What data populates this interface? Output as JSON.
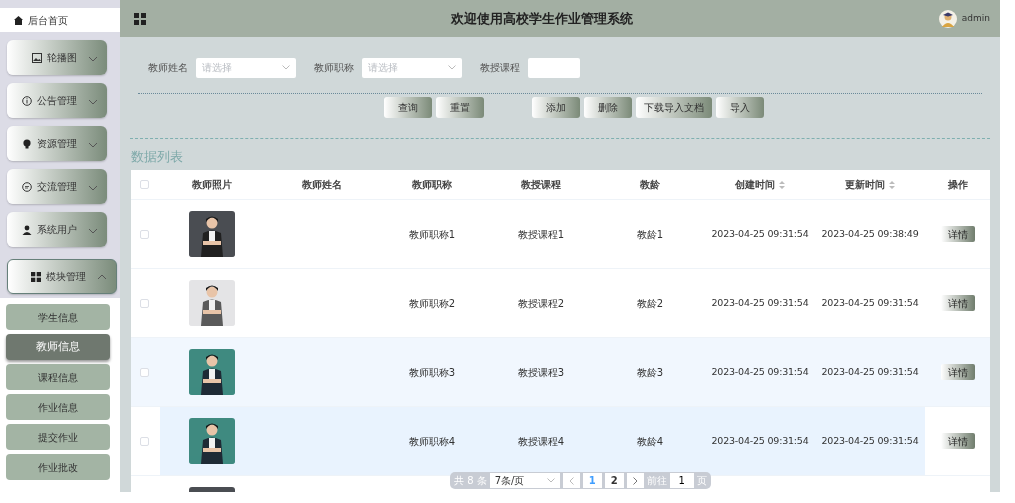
{
  "sidebar": {
    "home": {
      "label": "后台首页"
    },
    "menus": [
      {
        "label": "轮播图",
        "expanded": false
      },
      {
        "label": "公告管理",
        "expanded": false
      },
      {
        "label": "资源管理",
        "expanded": false
      },
      {
        "label": "交流管理",
        "expanded": false
      },
      {
        "label": "系统用户",
        "expanded": false
      },
      {
        "label": "模块管理",
        "expanded": true,
        "children": [
          {
            "label": "学生信息",
            "selected": false
          },
          {
            "label": "教师信息",
            "selected": true
          },
          {
            "label": "课程信息",
            "selected": false
          },
          {
            "label": "作业信息",
            "selected": false
          },
          {
            "label": "提交作业",
            "selected": false
          },
          {
            "label": "作业批改",
            "selected": false
          }
        ]
      }
    ]
  },
  "header": {
    "title": "欢迎使用高校学生作业管理系统",
    "user": "admin"
  },
  "filters": [
    {
      "label": "教师姓名",
      "kind": "select",
      "placeholder": "请选择"
    },
    {
      "label": "教师职称",
      "kind": "select",
      "placeholder": "请选择"
    },
    {
      "label": "教授课程",
      "kind": "text"
    }
  ],
  "search_buttons": [
    "查询",
    "重置"
  ],
  "action_buttons": [
    "添加",
    "删除",
    "下载导入文档",
    "导入"
  ],
  "list_title": "数据列表",
  "table": {
    "all_checked": false,
    "columns": [
      {
        "label": "教师照片",
        "sortable": false
      },
      {
        "label": "教师姓名",
        "sortable": false
      },
      {
        "label": "教师职称",
        "sortable": false
      },
      {
        "label": "教授课程",
        "sortable": false
      },
      {
        "label": "教龄",
        "sortable": false
      },
      {
        "label": "创建时间",
        "sortable": true
      },
      {
        "label": "更新时间",
        "sortable": true
      },
      {
        "label": "操作",
        "sortable": false
      }
    ],
    "rows": [
      {
        "striped": false,
        "hovered": false,
        "checked": false,
        "title": "教师职称1",
        "course": "教授课程1",
        "age": "教龄1",
        "created": "2023-04-25 09:31:54",
        "updated": "2023-04-25 09:38:49",
        "action": "详情"
      },
      {
        "striped": false,
        "hovered": false,
        "checked": false,
        "title": "教师职称2",
        "course": "教授课程2",
        "age": "教龄2",
        "created": "2023-04-25 09:31:54",
        "updated": "2023-04-25 09:31:54",
        "action": "详情"
      },
      {
        "striped": true,
        "hovered": false,
        "checked": false,
        "title": "教师职称3",
        "course": "教授课程3",
        "age": "教龄3",
        "created": "2023-04-25 09:31:54",
        "updated": "2023-04-25 09:31:54",
        "action": "详情"
      },
      {
        "striped": false,
        "hovered": true,
        "checked": false,
        "title": "教师职称4",
        "course": "教授课程4",
        "age": "教龄4",
        "created": "2023-04-25 09:31:54",
        "updated": "2023-04-25 09:31:54",
        "action": "详情"
      },
      {
        "striped": false,
        "hovered": false
      }
    ]
  },
  "pagination": {
    "total": "共 8 条",
    "page_size": "7条/页",
    "pages": [
      {
        "label": "1",
        "selected": true
      },
      {
        "label": "2",
        "selected": false
      }
    ],
    "goto_label": "前往",
    "goto_value": "1",
    "page_unit": "页"
  }
}
